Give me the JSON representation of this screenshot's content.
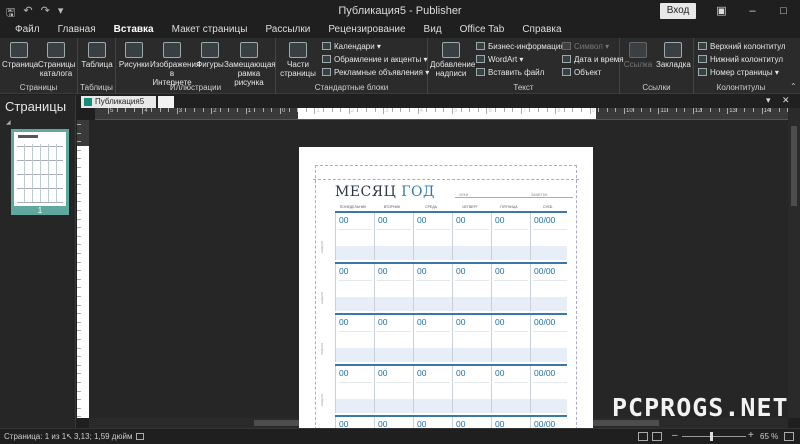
{
  "title_bar": {
    "title": "Публикация5  -  Publisher",
    "login_label": "Вход",
    "save_icon": "save-icon",
    "undo_icon": "undo-icon",
    "redo_icon": "redo-icon"
  },
  "tabs": [
    "Файл",
    "Главная",
    "Вставка",
    "Макет страницы",
    "Рассылки",
    "Рецензирование",
    "Вид",
    "Office Tab",
    "Справка"
  ],
  "active_tab": "Вставка",
  "ribbon": {
    "pages_group": {
      "label": "Страницы",
      "page_btn": "Страница",
      "catalog_btn": "Страницы каталога"
    },
    "tables_group": {
      "label": "Таблицы",
      "table_btn": "Таблица"
    },
    "illustrations_group": {
      "label": "Иллюстрации",
      "pictures": "Рисунки",
      "online": "Изображения в Интернете",
      "shapes": "Фигуры",
      "placeholder": "Замещающая рамка рисунка"
    },
    "blocks_group": {
      "label": "Стандартные блоки",
      "parts": "Части страницы",
      "calendars": "Календари",
      "borders": "Обрамление и акценты",
      "ads": "Рекламные объявления"
    },
    "text_group": {
      "label": "Текст",
      "textbox": "Добавление надписи",
      "bizinfo": "Бизнес-информация",
      "wordart": "WordArt",
      "insert_file": "Вставить файл",
      "symbol": "Символ",
      "datetime": "Дата и время",
      "object": "Объект"
    },
    "links_group": {
      "label": "Ссылки",
      "link": "Ссылка",
      "bookmark": "Закладка"
    },
    "hf_group": {
      "label": "Колонтитулы",
      "header": "Верхний колонтитул",
      "footer": "Нижний колонтитул",
      "page_number": "Номер страницы"
    }
  },
  "pages_pane": {
    "title": "Страницы",
    "thumb_number": "1"
  },
  "document_tab": {
    "name": "Публикация5"
  },
  "ruler": {
    "labels": [
      "5",
      "4",
      "3",
      "2",
      "1",
      "0",
      "1",
      "2",
      "3",
      "4",
      "5",
      "6",
      "7",
      "8",
      "9",
      "10",
      "11",
      "12",
      "13",
      "14"
    ]
  },
  "calendar": {
    "month": "МЕСЯЦ",
    "year": "ГОД",
    "days": [
      "ПОНЕДЕЛЬНИК",
      "ВТОРНИК",
      "СРЕДА",
      "ЧЕТВЕРГ",
      "ПЯТНИЦА",
      "СУББ."
    ],
    "day_numbers": [
      "00",
      "00",
      "00",
      "00",
      "00",
      "00/00"
    ],
    "row_label": "НЕДЕЛЯ",
    "header_meta": [
      "ЧЕКИ",
      "ЗАМЕТКИ"
    ]
  },
  "status_bar": {
    "page": "Страница: 1 из 1",
    "position": "3,13; 1,59 дюйм",
    "zoom": "65 %"
  },
  "watermark": "PCPROGS.NET"
}
